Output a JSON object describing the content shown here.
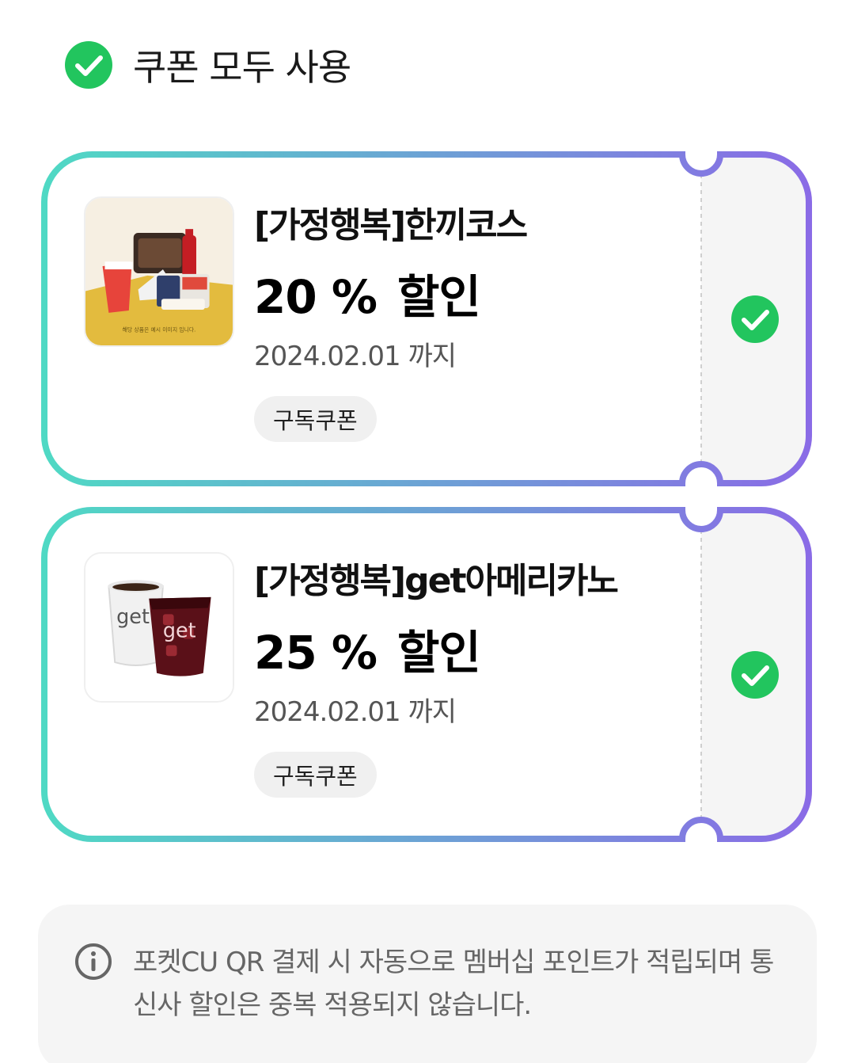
{
  "header": {
    "use_all_label": "쿠폰 모두 사용",
    "use_all_checked": true,
    "check_color": "#22c55e"
  },
  "coupons": [
    {
      "title": "[가정행복]한끼코스",
      "discount_value": "20 %",
      "discount_word": "할인",
      "expiry": "2024.02.01 까지",
      "tag": "구독쿠폰",
      "selected": true,
      "image_icon": "meal-course-product-image",
      "image_caption": "해당 상품은 예시 이미지 입니다."
    },
    {
      "title": "[가정행복]get아메리카노",
      "discount_value": "25 %",
      "discount_word": "할인",
      "expiry": "2024.02.01 까지",
      "tag": "구독쿠폰",
      "selected": true,
      "image_icon": "get-americano-cups-image",
      "image_label": "get"
    }
  ],
  "notice": {
    "icon": "info-icon",
    "text": "포켓CU QR 결제 시 자동으로 멤버십 포인트가 적립되며 통신사 할인은 중복 적용되지 않습니다."
  },
  "colors": {
    "frame_gradient_start": "#4fd9c4",
    "frame_gradient_end": "#8a6be6",
    "stub_background": "#f5f5f5",
    "check_green": "#22c55e",
    "notice_background": "#f5f5f5"
  }
}
